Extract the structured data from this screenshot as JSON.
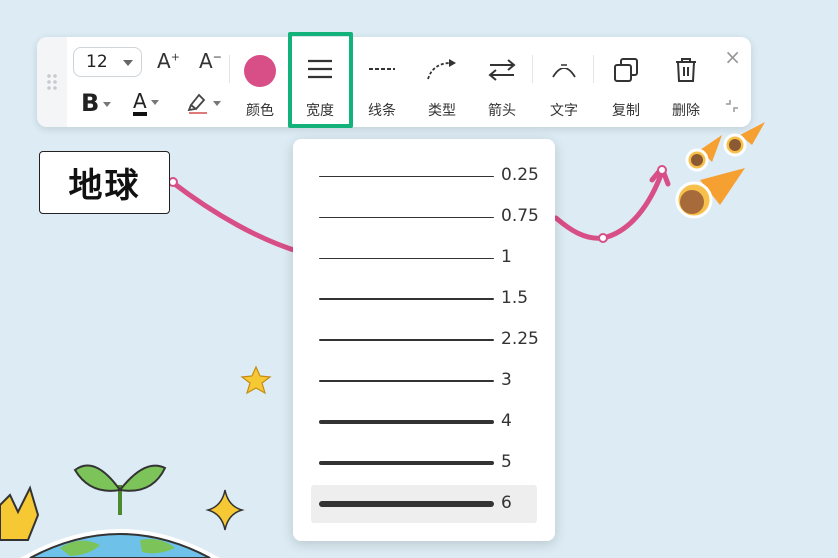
{
  "toolbar": {
    "font_size": "12",
    "increase_font_label": "A",
    "increase_font_sup": "+",
    "decrease_font_label": "A",
    "decrease_font_sup": "−",
    "bold_label": "B",
    "font_color_label": "A",
    "color": {
      "label": "颜色",
      "value": "#d84e86"
    },
    "width": {
      "label": "宽度"
    },
    "line_style": {
      "label": "线条"
    },
    "type": {
      "label": "类型"
    },
    "arrow": {
      "label": "箭头"
    },
    "text": {
      "label": "文字"
    },
    "copy": {
      "label": "复制"
    },
    "delete": {
      "label": "删除"
    },
    "close": "×"
  },
  "node": {
    "label": "地球"
  },
  "width_dropdown": {
    "options": [
      {
        "label": "0.25",
        "thickness": 0.25
      },
      {
        "label": "0.75",
        "thickness": 0.75
      },
      {
        "label": "1",
        "thickness": 1
      },
      {
        "label": "1.5",
        "thickness": 1.5
      },
      {
        "label": "2.25",
        "thickness": 2.25
      },
      {
        "label": "3",
        "thickness": 3
      },
      {
        "label": "4",
        "thickness": 4
      },
      {
        "label": "5",
        "thickness": 5
      },
      {
        "label": "6",
        "thickness": 6,
        "selected": true
      }
    ]
  },
  "colors": {
    "accent_highlight": "#12b27a",
    "connector": "#d84e86",
    "background": "#dcebf4"
  }
}
